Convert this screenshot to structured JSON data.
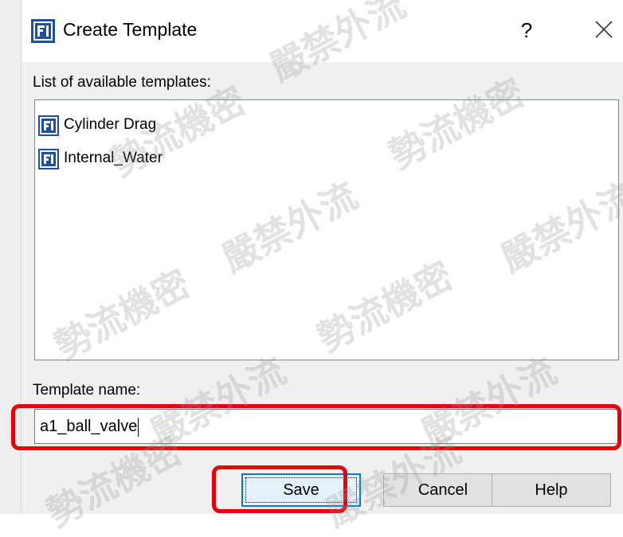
{
  "dialog": {
    "title": "Create Template",
    "help_glyph": "?",
    "list_label": "List of available templates:",
    "templates": [
      {
        "label": "Cylinder Drag",
        "icon": "template-icon"
      },
      {
        "label": "Internal_Water",
        "icon": "template-icon"
      }
    ],
    "name_label": "Template name:",
    "name_value": "a1_ball_valve",
    "buttons": {
      "save": "Save",
      "cancel": "Cancel",
      "help": "Help"
    }
  },
  "watermarks": [
    "嚴禁外流",
    "勢流機密",
    "嚴禁外流",
    "勢流機密",
    "嚴禁外流",
    "勢流機密",
    "嚴禁外流",
    "勢流機密"
  ],
  "colors": {
    "highlight": "#e8000b",
    "icon_blue": "#1e4fa0",
    "default_button_border": "#0078d7"
  }
}
